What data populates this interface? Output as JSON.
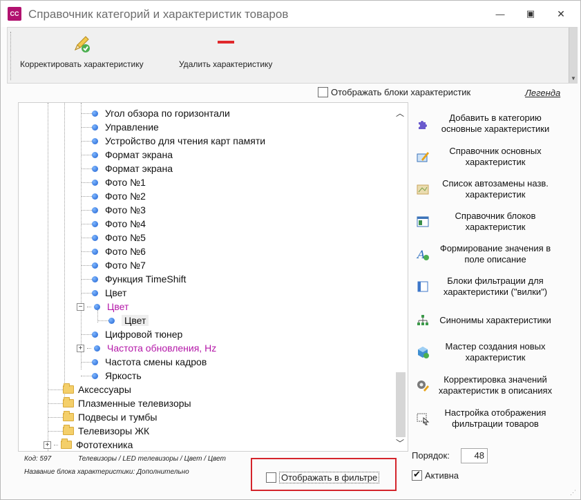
{
  "window": {
    "title": "Справочник категорий и характеристик товаров",
    "icon_text": "CC",
    "minimize_glyph": "—",
    "maximize_glyph": "▣",
    "close_glyph": "✕"
  },
  "toolbar": {
    "edit_label": "Корректировать характеристику",
    "delete_label": "Удалить характеристику"
  },
  "options": {
    "show_blocks_label": "Отображать блоки характеристик",
    "show_blocks_checked": false,
    "legend_label": "Легенда"
  },
  "tree": {
    "items": [
      {
        "label": "Угол обзора по горизонтали",
        "kind": "leaf"
      },
      {
        "label": "Управление",
        "kind": "leaf"
      },
      {
        "label": "Устройство для чтения карт памяти",
        "kind": "leaf"
      },
      {
        "label": "Формат экрана",
        "kind": "leaf"
      },
      {
        "label": "Формат экрана",
        "kind": "leaf"
      },
      {
        "label": "Фото №1",
        "kind": "leaf"
      },
      {
        "label": "Фото №2",
        "kind": "leaf"
      },
      {
        "label": "Фото №3",
        "kind": "leaf"
      },
      {
        "label": "Фото №4",
        "kind": "leaf"
      },
      {
        "label": "Фото №5",
        "kind": "leaf"
      },
      {
        "label": "Фото №6",
        "kind": "leaf"
      },
      {
        "label": "Фото №7",
        "kind": "leaf"
      },
      {
        "label": "Функция TimeShift",
        "kind": "leaf"
      },
      {
        "label": "Цвет",
        "kind": "leaf"
      },
      {
        "label": "Цвет",
        "kind": "parent-expanded",
        "color": "#b417a8"
      },
      {
        "label": "Цвет",
        "kind": "child-selected"
      },
      {
        "label": "Цифровой тюнер",
        "kind": "leaf"
      },
      {
        "label": "Частота обновления, Hz",
        "kind": "parent-collapsed",
        "color": "#b417a8"
      },
      {
        "label": "Частота смены кадров",
        "kind": "leaf"
      },
      {
        "label": "Яркость",
        "kind": "leaf"
      },
      {
        "label": "Аксессуары",
        "kind": "folder"
      },
      {
        "label": "Плазменные телевизоры",
        "kind": "folder"
      },
      {
        "label": "Подвесы и тумбы",
        "kind": "folder"
      },
      {
        "label": "Телевизоры ЖК",
        "kind": "folder"
      },
      {
        "label": "Фототехника",
        "kind": "folder-collapsed"
      }
    ],
    "scroll_up_glyph": "︿",
    "scroll_down_glyph": "﹀"
  },
  "actions": [
    {
      "label": "Добавить в категорию основные характеристики",
      "icon": "puzzle-icon",
      "color": "#6a5acd"
    },
    {
      "label": "Справочник основных характеристик",
      "icon": "edit-card-icon",
      "color": "#e8a317"
    },
    {
      "label": "Список автозамены назв. характеристик",
      "icon": "map-icon",
      "color": "#c9a45c"
    },
    {
      "label": "Справочник блоков характеристик",
      "icon": "window-icon",
      "color": "#3a8f4a"
    },
    {
      "label": "Формирование значения в поле описание",
      "icon": "font-add-icon",
      "color": "#2d6fbf"
    },
    {
      "label": "Блоки фильтрации для характеристики (\"вилки\")",
      "icon": "panel-icon",
      "color": "#3d77c9"
    },
    {
      "label": "Синонимы характеристики",
      "icon": "hierarchy-icon",
      "color": "#3c9a4a"
    },
    {
      "label": "Мастер создания новых характеристик",
      "icon": "cube-add-icon",
      "color": "#3f8fd1"
    },
    {
      "label": "Корректировка значений характеристик в описаниях",
      "icon": "gear-edit-icon",
      "color": "#7a7a7a"
    },
    {
      "label": "Настройка отображения фильтрации товаров",
      "icon": "select-icon",
      "color": "#555555"
    }
  ],
  "info": {
    "code": "Код: 597",
    "path": "Телевизоры / LED телевизоры / Цвет / Цвет",
    "block_name": "Название блока характеристики: Дополнительно"
  },
  "filter": {
    "label": "Отображать в фильтре",
    "checked": false,
    "highlight_color": "#d4242b"
  },
  "order": {
    "label": "Порядок:",
    "value": "48"
  },
  "active": {
    "label": "Активна",
    "checked": true
  }
}
